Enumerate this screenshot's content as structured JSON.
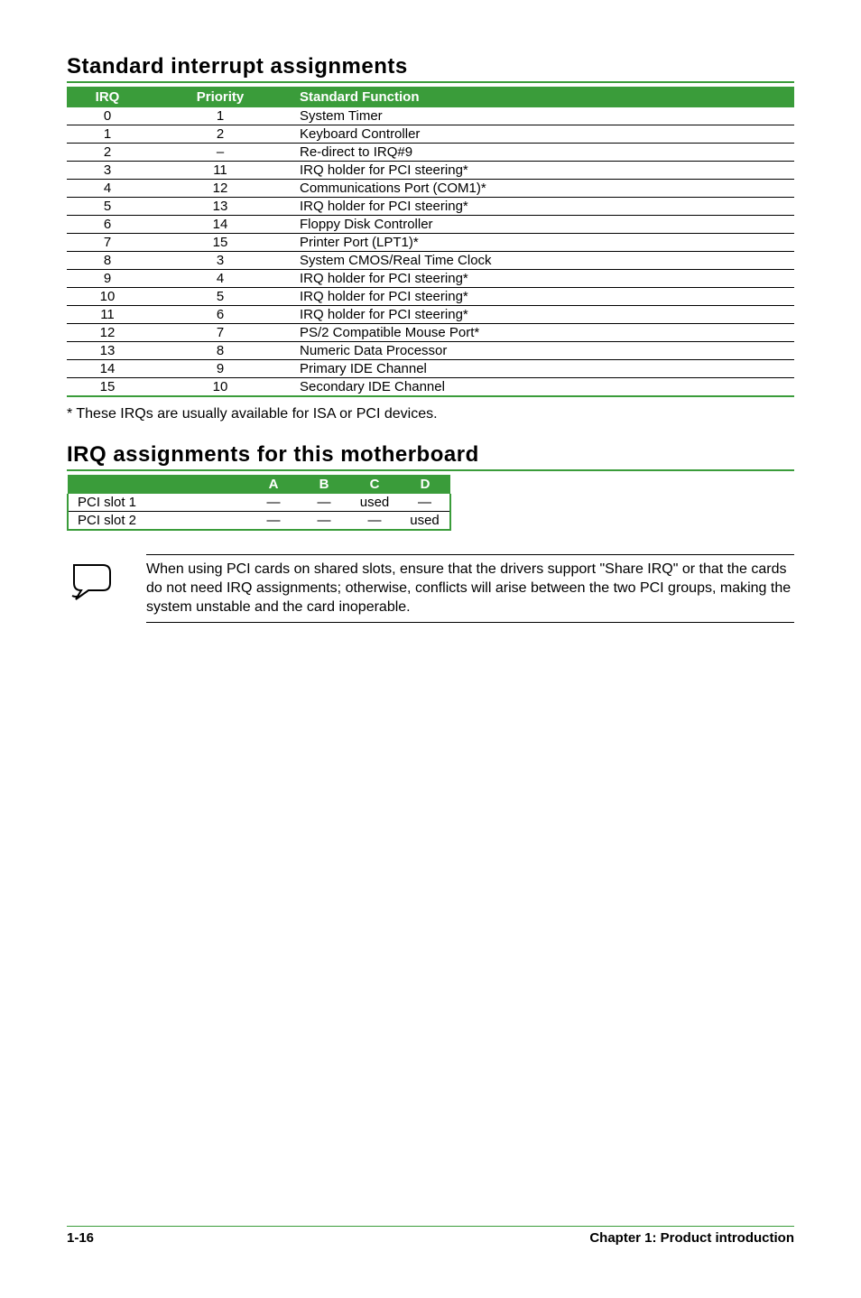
{
  "section1": {
    "title": "Standard interrupt assignments",
    "headers": [
      "IRQ",
      "Priority",
      "Standard Function"
    ],
    "rows": [
      [
        "0",
        "1",
        "System Timer"
      ],
      [
        "1",
        "2",
        "Keyboard Controller"
      ],
      [
        "2",
        "–",
        "Re-direct to IRQ#9"
      ],
      [
        "3",
        "11",
        "IRQ holder for PCI steering*"
      ],
      [
        "4",
        "12",
        "Communications Port (COM1)*"
      ],
      [
        "5",
        "13",
        "IRQ holder for PCI steering*"
      ],
      [
        "6",
        "14",
        "Floppy Disk Controller"
      ],
      [
        "7",
        "15",
        "Printer Port (LPT1)*"
      ],
      [
        "8",
        "3",
        "System CMOS/Real Time Clock"
      ],
      [
        "9",
        "4",
        "IRQ holder for PCI steering*"
      ],
      [
        "10",
        "5",
        "IRQ holder for PCI steering*"
      ],
      [
        "11",
        "6",
        "IRQ holder for PCI steering*"
      ],
      [
        "12",
        "7",
        "PS/2 Compatible Mouse Port*"
      ],
      [
        "13",
        "8",
        "Numeric Data Processor"
      ],
      [
        "14",
        "9",
        "Primary IDE Channel"
      ],
      [
        "15",
        "10",
        "Secondary IDE Channel"
      ]
    ],
    "footnote": "* These IRQs are usually available for ISA or PCI devices."
  },
  "section2": {
    "title": "IRQ assignments for this motherboard",
    "headers": [
      "",
      "A",
      "B",
      "C",
      "D"
    ],
    "rows": [
      [
        "PCI slot 1",
        "—",
        "—",
        "used",
        "—"
      ],
      [
        "PCI slot 2",
        "—",
        "—",
        "—",
        "used"
      ]
    ]
  },
  "callout": {
    "text": "When using PCI cards on shared slots, ensure that the drivers support \"Share IRQ\" or that the cards do not need IRQ assignments; otherwise, conflicts will arise between the two PCI groups, making the system unstable and the card inoperable."
  },
  "footer": {
    "page": "1-16",
    "chapter": "Chapter 1: Product introduction"
  }
}
